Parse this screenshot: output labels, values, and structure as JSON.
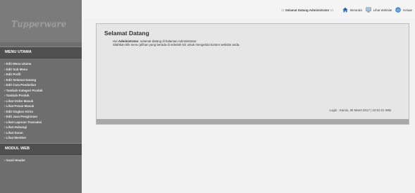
{
  "logo": {
    "text": "Tupperware"
  },
  "sidebar": {
    "menu_utama_title": "MENU UTAMA",
    "menu_utama_items": [
      "› Edit Menu Utama",
      "› Edit Sub Menu",
      "› Edit Profil",
      "› Edit Selamat Datang",
      "› Edit Cara Pembelian",
      "› Tambah Kategori Produk",
      "› Tambah Produk",
      "› Lihat Order Masuk",
      "› Lihat Pesan Masuk",
      "› Edit Ongkos Kirim",
      "› Edit Jasa Pengiriman",
      "› Lihat Laporan Transaksi",
      "› Lihat Hubungi",
      "› Lihat Saran",
      "› Lihat Member"
    ],
    "modul_web_title": "MODUL WEB",
    "modul_web_items": [
      "› Ganti Header"
    ]
  },
  "topbar": {
    "welcome": "::: Selamat Datang Administrator :::",
    "home_label": "Beranda",
    "view_site_label": "Lihat Website",
    "logout_label": "Keluar"
  },
  "panel": {
    "title": "Selamat Datang",
    "line1_prefix": "Hai ",
    "line1_bold": "Administrator",
    "line1_suffix": ", selamat datang di halaman Administrator.",
    "line2": "Silahkan klik menu pilihan yang berada di sebelah kiri untuk mengelola konten website anda.",
    "login_info": "Login : Kamis, 30 Maret 2017 | 22:51:21 WIB"
  },
  "colors": {
    "sidebar_bg": "#6e6e6e",
    "menu_header_bg": "#505050",
    "page_bg": "#f2f2f2",
    "panel_bg": "#e6e6e6",
    "home_icon": "#2b62a8",
    "logout_icon": "#2f76c8"
  },
  "icons": {
    "home": "house-icon",
    "view_site": "monitor-icon",
    "logout": "power-icon"
  }
}
